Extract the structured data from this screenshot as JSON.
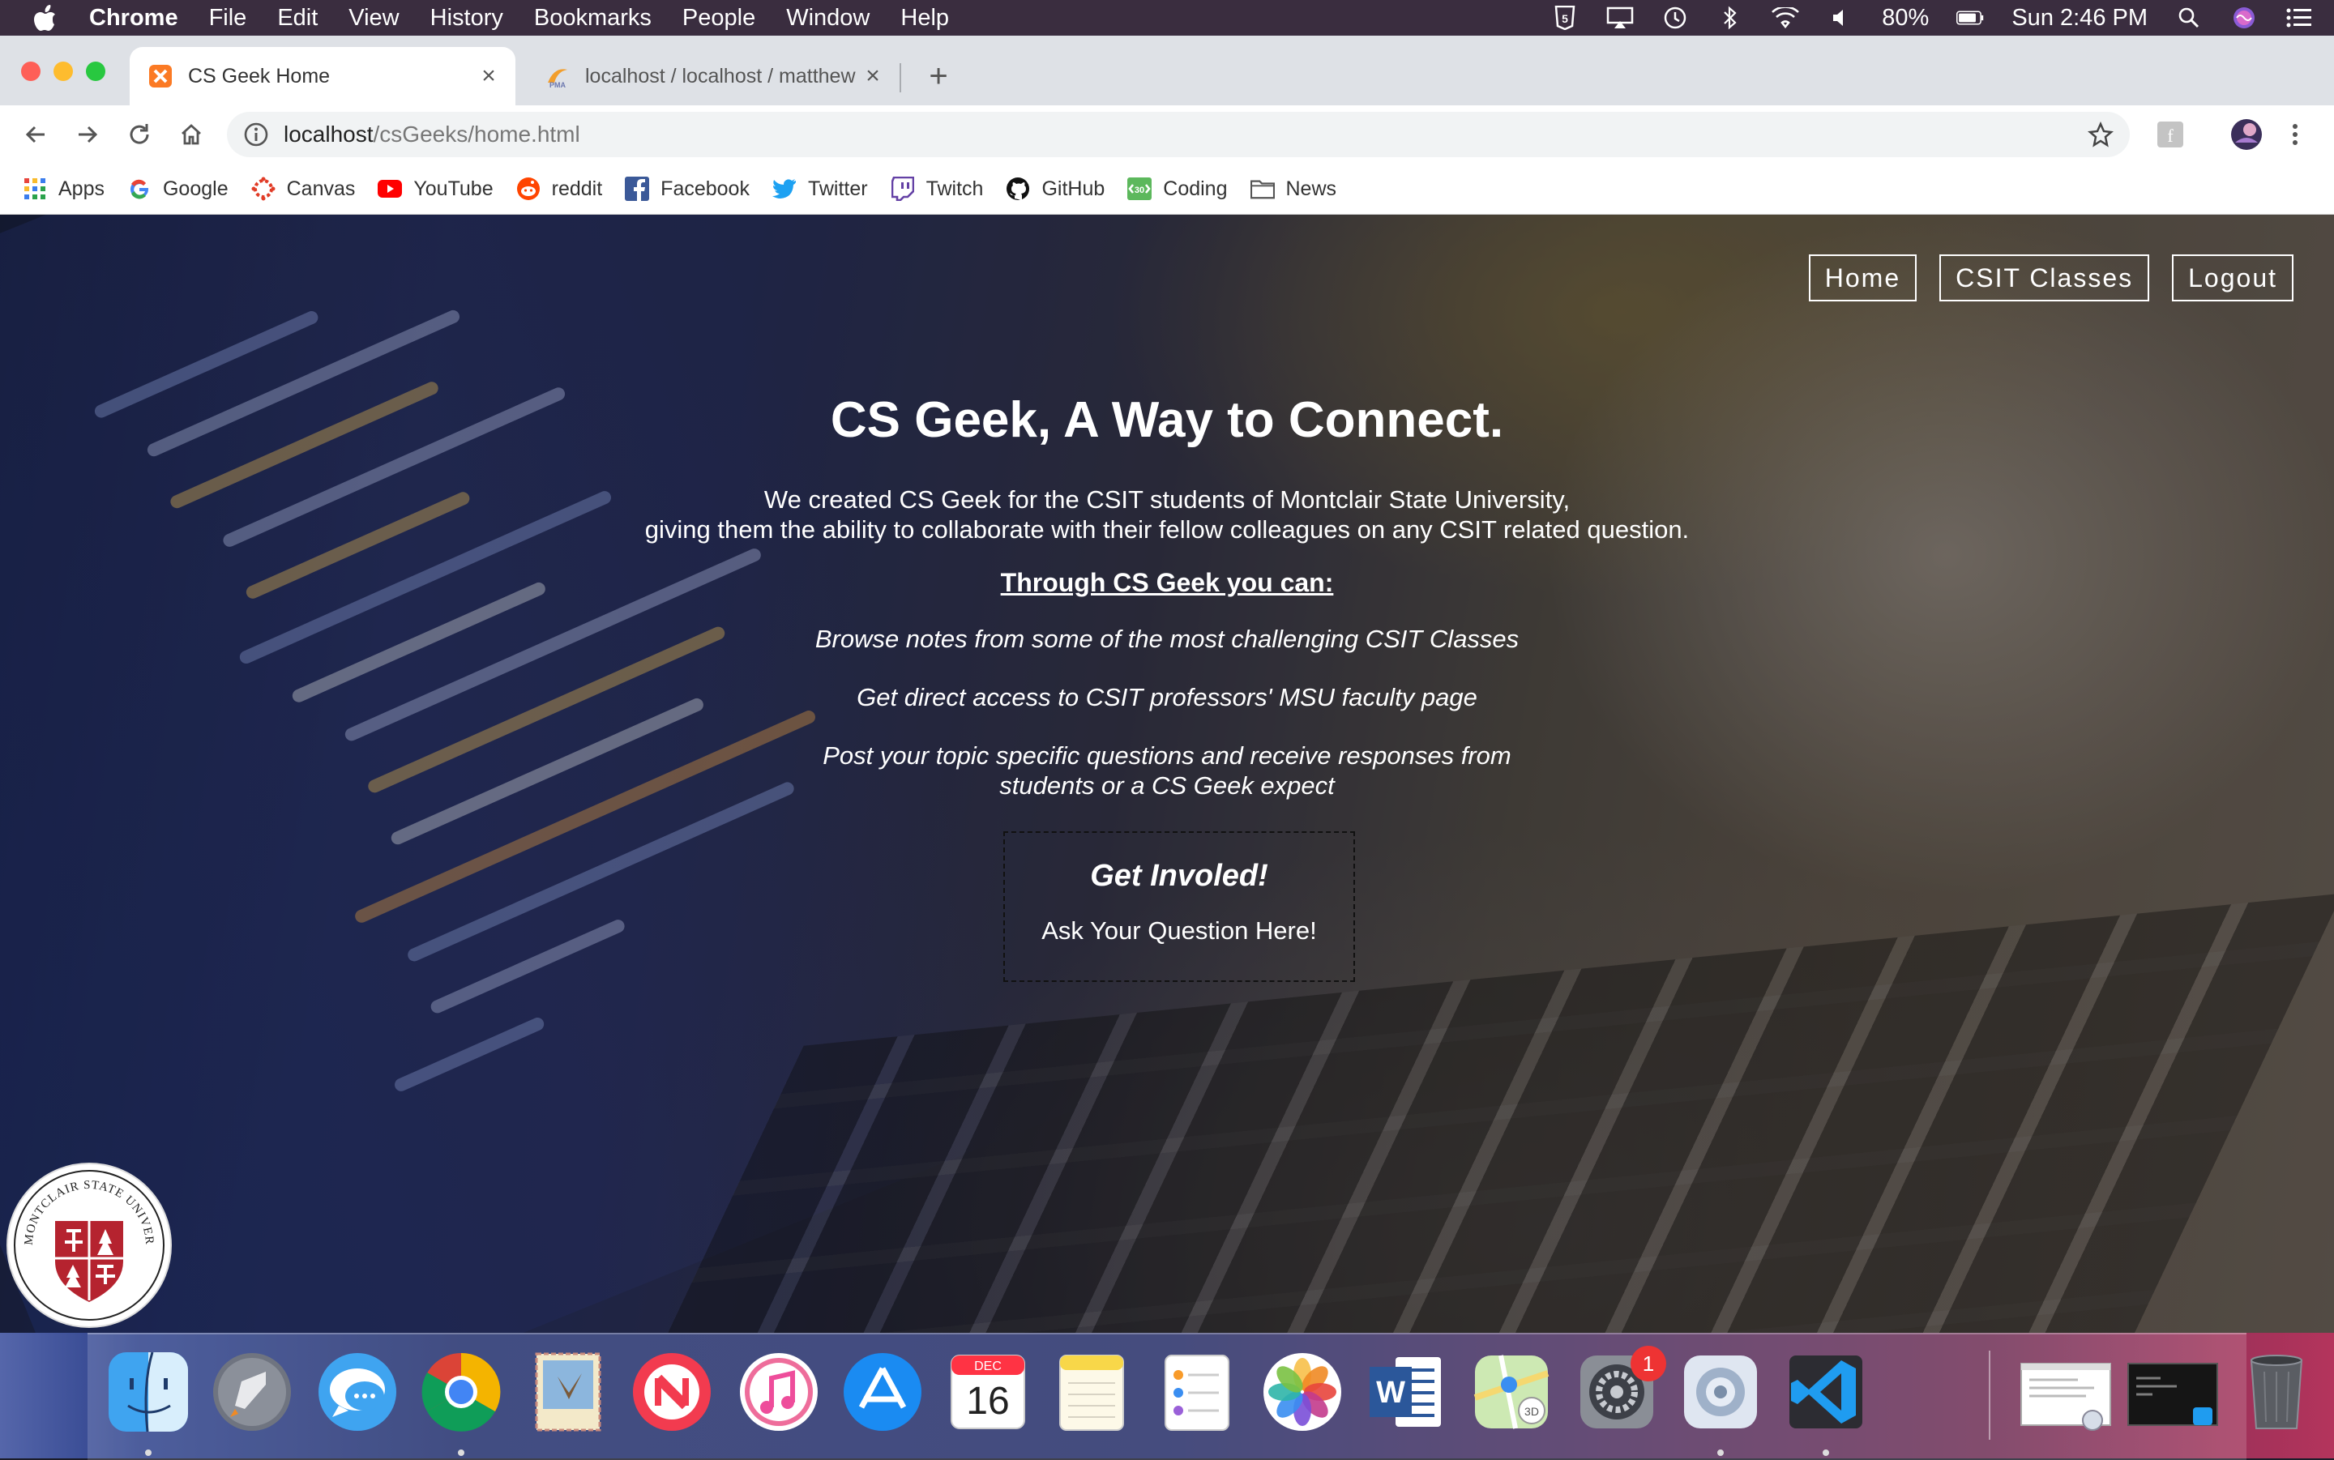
{
  "menubar": {
    "app_name": "Chrome",
    "items": [
      "File",
      "Edit",
      "View",
      "History",
      "Bookmarks",
      "People",
      "Window",
      "Help"
    ],
    "battery": "80%",
    "clock": "Sun 2:46 PM"
  },
  "tabs": [
    {
      "title": "CS Geek Home",
      "active": true
    },
    {
      "title": "localhost / localhost / matthew",
      "active": false
    }
  ],
  "omnibox": {
    "host": "localhost",
    "path": "/csGeeks/home.html"
  },
  "bookmarks": [
    "Apps",
    "Google",
    "Canvas",
    "YouTube",
    "reddit",
    "Facebook",
    "Twitter",
    "Twitch",
    "GitHub",
    "Coding",
    "News"
  ],
  "site": {
    "nav": [
      "Home",
      "CSIT Classes",
      "Logout"
    ],
    "headline": "CS Geek, A Way to Connect.",
    "intro_line1": "We created CS Geek for the CSIT students of Montclair State University,",
    "intro_line2": "giving them the ability to collaborate with their fellow colleagues on any CSIT related question.",
    "subheading": "Through CS Geek you can:",
    "features": [
      "Browse notes from some of the most challenging CSIT Classes",
      "Get direct access to CSIT professors' MSU faculty page",
      "Post your topic specific questions and receive responses from",
      "students or a CS Geek expect"
    ],
    "cta_title": "Get Involed!",
    "cta_link": "Ask Your Question Here!",
    "seal_text": "MONTCLAIR STATE UNIVERSITY"
  },
  "dock": {
    "calendar_month": "DEC",
    "calendar_day": "16",
    "notification_badge": "1"
  },
  "colors": {
    "menubar_bg": "#3a2d3f",
    "tabstrip_bg": "#dee1e6",
    "seal_red": "#b5232f"
  }
}
